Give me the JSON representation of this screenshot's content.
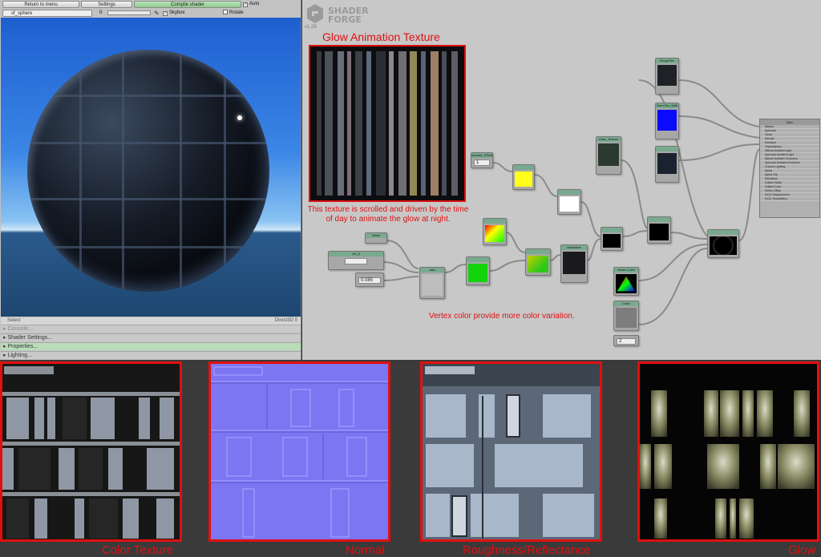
{
  "toolbar": {
    "return_label": "Return to menu",
    "settings_label": "Settings",
    "compile_label": "Compile shader",
    "auto_label": "Auto",
    "model_value": "sf_sphere",
    "slider_value": "0",
    "skybox_label": "Skybox",
    "rotate_label": "Rotate"
  },
  "status": {
    "select_label": "Select",
    "renderer": "Direct3D 9"
  },
  "panels": [
    {
      "label": "Console..."
    },
    {
      "label": "Shader Settings..."
    },
    {
      "label": "Properties..."
    },
    {
      "label": "Lighting..."
    }
  ],
  "graph": {
    "logo_text_1": "SHADER",
    "logo_text_2": "FORGE",
    "version": "v1.28",
    "glow_title": "Glow Animation Texture",
    "glow_caption": "This texture is scrolled and driven by the time of day to animate the glow at night.",
    "vertex_note": "Vertex color provide more color variation.",
    "nodes": {
      "uvscale": "uvscale_XScrll",
      "uvscale_val": "1",
      "value1": "Value",
      "value2_num": "0.085",
      "uv_label": "UV_0",
      "glow_tex": "Glow_Texture",
      "rough_tex": "RoughTex",
      "normal_tex": "NormTex_Wall",
      "vertex_color": "Vertex Color",
      "color_node": "Color",
      "value3_num": "2",
      "anim": "Animation",
      "add": "Add",
      "main": "Main"
    },
    "main_inputs": [
      "Albedo",
      "Specular",
      "Gloss",
      "Normal",
      "Emission",
      "Transmission",
      "Diffuse Ambient Light",
      "Specular Ambient Light",
      "Diffuse Ambient Occlusion",
      "Specular Ambient Occlusion",
      "Custom Lighting",
      "Alpha",
      "Alpha Clip",
      "Refraction",
      "Outline Width",
      "Outline Color",
      "Vertex Offset",
      "DX11 Displacement",
      "DX11 Tessellation"
    ]
  },
  "textures": {
    "color_label": "Color Texture",
    "normal_label": "Normal",
    "rough_label": "Roughness/Reflectance",
    "glow_label": "Glow"
  },
  "colors": {
    "accent_red": "#e01010",
    "node_header": "#79a98f",
    "active_panel": "#b8ddb8"
  }
}
